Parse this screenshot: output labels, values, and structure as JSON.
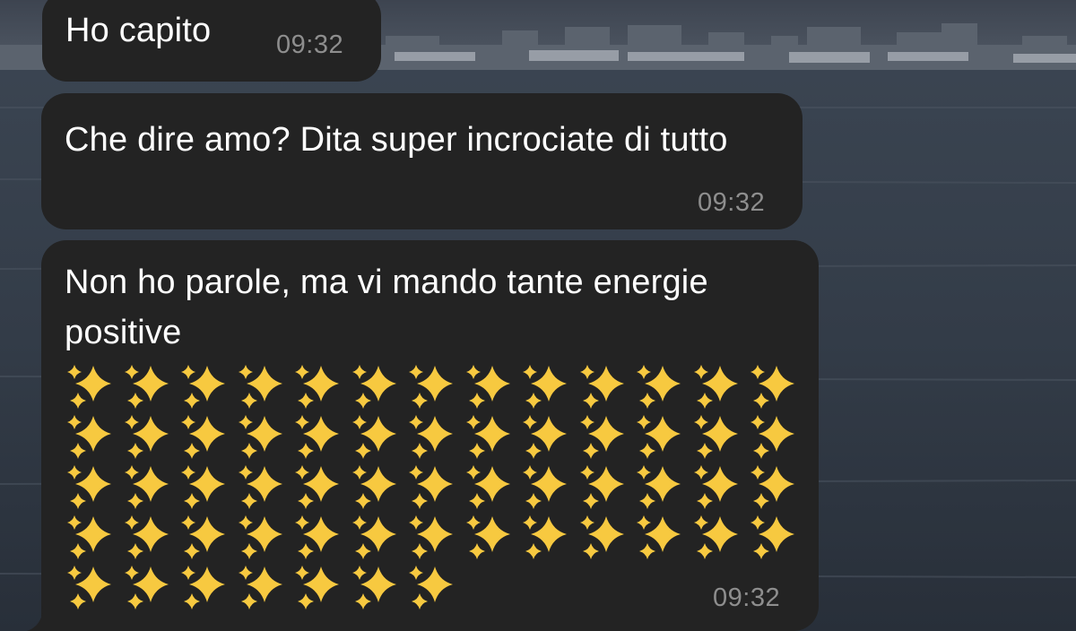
{
  "messages": [
    {
      "text": "Ho capito",
      "time": "09:32"
    },
    {
      "text": "Che dire amo? Dita super incrociate di tutto",
      "time": "09:32"
    },
    {
      "text": "Non ho parole, ma vi mando tante energie positive",
      "sparkle_rows": [
        13,
        13,
        13,
        13,
        7
      ],
      "time": "09:32"
    }
  ],
  "colors": {
    "bubble": "#232323",
    "text": "#ffffff",
    "time": "#8e8e8e",
    "sparkle": "#f7c940"
  },
  "icons": {
    "sparkle": "sparkles-emoji-icon"
  }
}
